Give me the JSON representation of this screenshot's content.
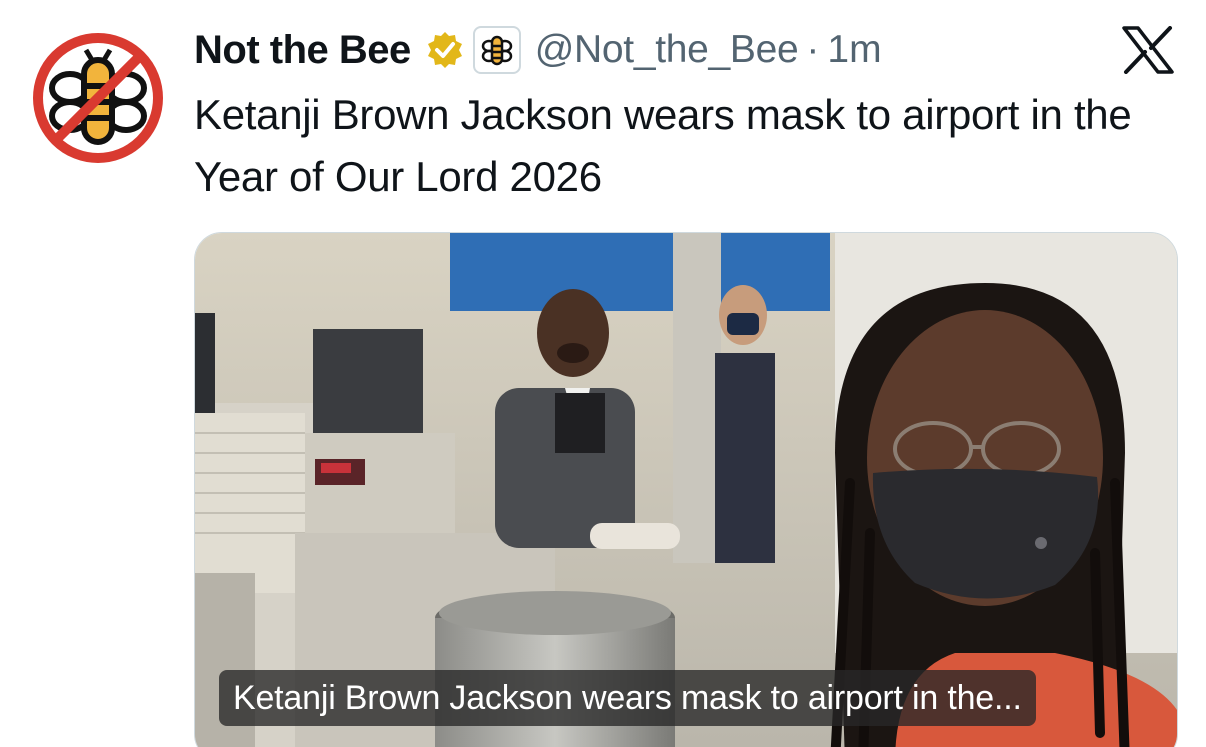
{
  "tweet": {
    "display_name": "Not the Bee",
    "handle": "@Not_the_Bee",
    "separator": "·",
    "time": "1m",
    "text": "Ketanji Brown Jackson wears mask to airport in the Year of Our Lord 2026",
    "media_caption": "Ketanji Brown Jackson wears mask to airport in the..."
  },
  "icons": {
    "avatar": "not-the-bee-logo",
    "verified": "verified-badge-gold",
    "affiliate": "bee-affiliate-badge",
    "platform": "x-logo"
  },
  "colors": {
    "verified_gold": "#e2b719",
    "no_sign_red": "#d93a30",
    "bee_yellow": "#f2b43c",
    "text_primary": "#0f1419",
    "text_secondary": "#536471"
  }
}
